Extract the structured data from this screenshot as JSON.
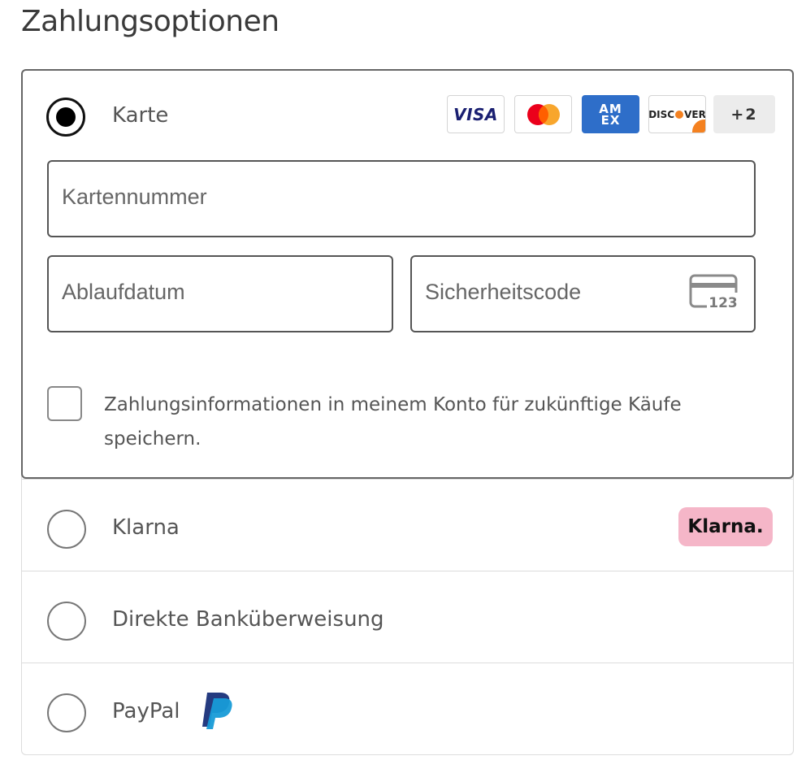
{
  "page": {
    "title": "Zahlungsoptionen"
  },
  "card_option": {
    "label": "Karte",
    "selected": true,
    "brands": [
      {
        "icon": "visa-logo",
        "text": "VISA"
      },
      {
        "icon": "mastercard-logo"
      },
      {
        "icon": "amex-logo",
        "text": "AM\nEX"
      },
      {
        "icon": "discover-logo",
        "text": "DISCOVER"
      }
    ],
    "more_brands": "+2",
    "fields": {
      "card_number_placeholder": "Kartennummer",
      "expiry_placeholder": "Ablaufdatum",
      "security_code_placeholder": "Sicherheitscode",
      "security_code_hint": "123"
    },
    "save_checkbox": {
      "checked": false,
      "label": "Zahlungsinformationen in meinem Konto für zukünftige Käufe speichern."
    }
  },
  "other_options": [
    {
      "label": "Klarna",
      "badge": "Klarna.",
      "selected": false
    },
    {
      "label": "Direkte Banküberweisung",
      "selected": false
    },
    {
      "label": "PayPal",
      "icon": "paypal-logo",
      "selected": false
    }
  ],
  "colors": {
    "klarna_pink": "#f5b6c8",
    "amex_blue": "#2e6ec9",
    "visa_navy": "#1a1f71",
    "mastercard_red": "#eb001b",
    "mastercard_orange": "#f79e1b",
    "paypal_dark": "#253b80",
    "paypal_light": "#179bd7"
  }
}
